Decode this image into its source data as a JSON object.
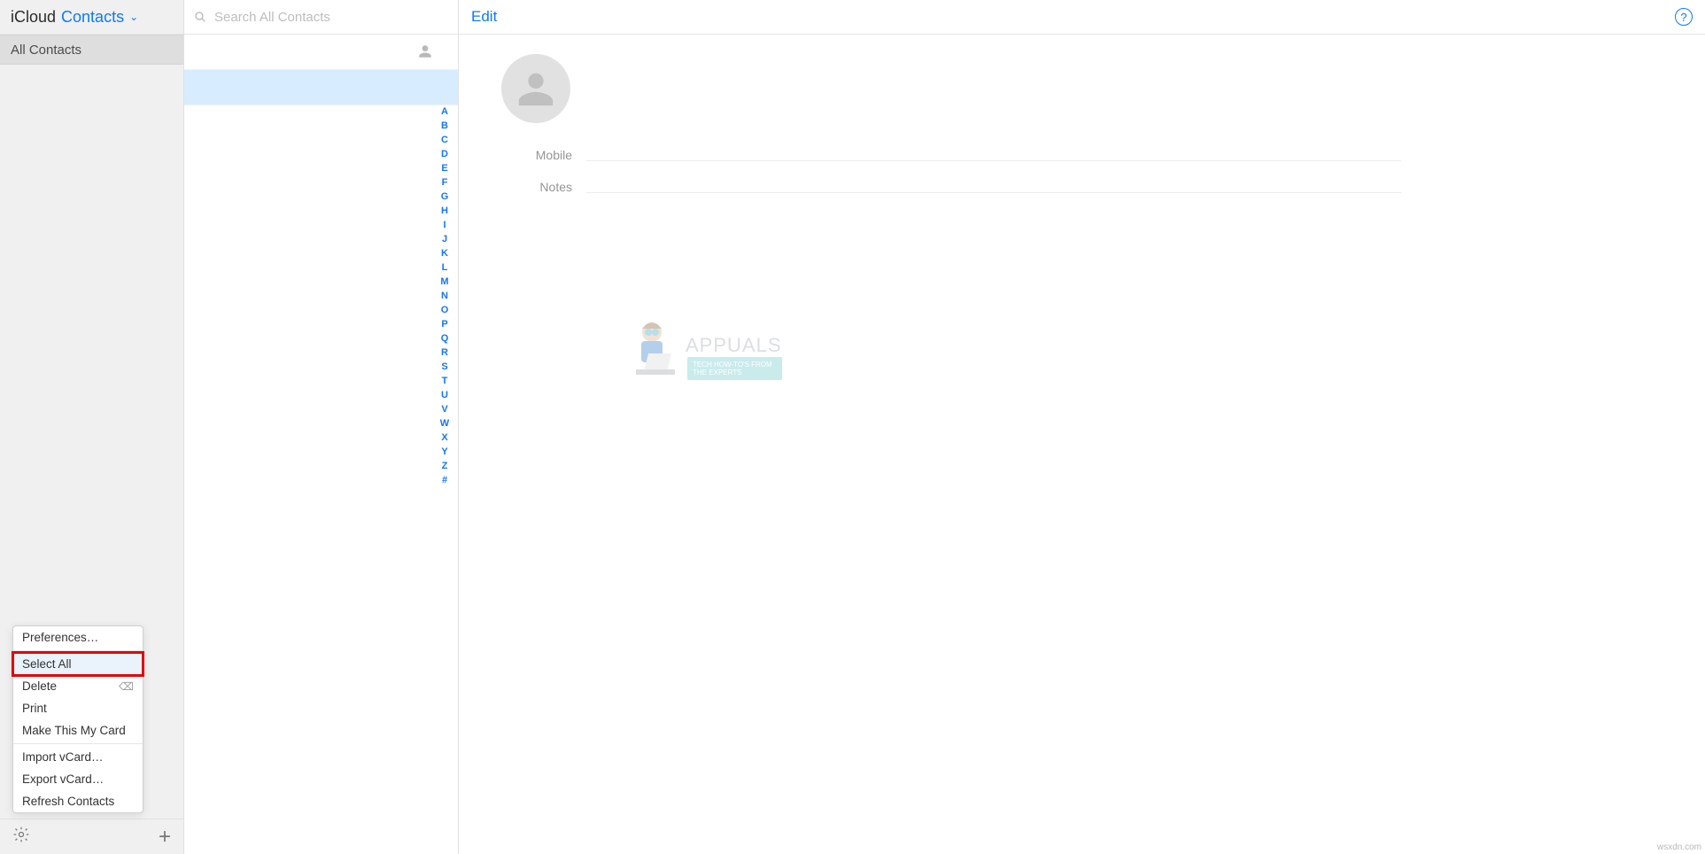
{
  "header": {
    "app_title": "iCloud",
    "section_title": "Contacts",
    "group_label": "All Contacts",
    "search_placeholder": "Search All Contacts",
    "edit_label": "Edit"
  },
  "index_letters": [
    "A",
    "B",
    "C",
    "D",
    "E",
    "F",
    "G",
    "H",
    "I",
    "J",
    "K",
    "L",
    "M",
    "N",
    "O",
    "P",
    "Q",
    "R",
    "S",
    "T",
    "U",
    "V",
    "W",
    "X",
    "Y",
    "Z",
    "#"
  ],
  "detail": {
    "mobile_label": "Mobile",
    "notes_label": "Notes"
  },
  "menu": {
    "preferences": "Preferences…",
    "select_all": "Select All",
    "delete": "Delete",
    "delete_key": "⌫",
    "print": "Print",
    "make_card": "Make This My Card",
    "import_vcard": "Import vCard…",
    "export_vcard": "Export vCard…",
    "refresh": "Refresh Contacts"
  },
  "watermark": {
    "brand": "APPUALS",
    "tag1": "TECH HOW-TO'S FROM",
    "tag2": "THE EXPERTS"
  },
  "source": "wsxdn.com"
}
